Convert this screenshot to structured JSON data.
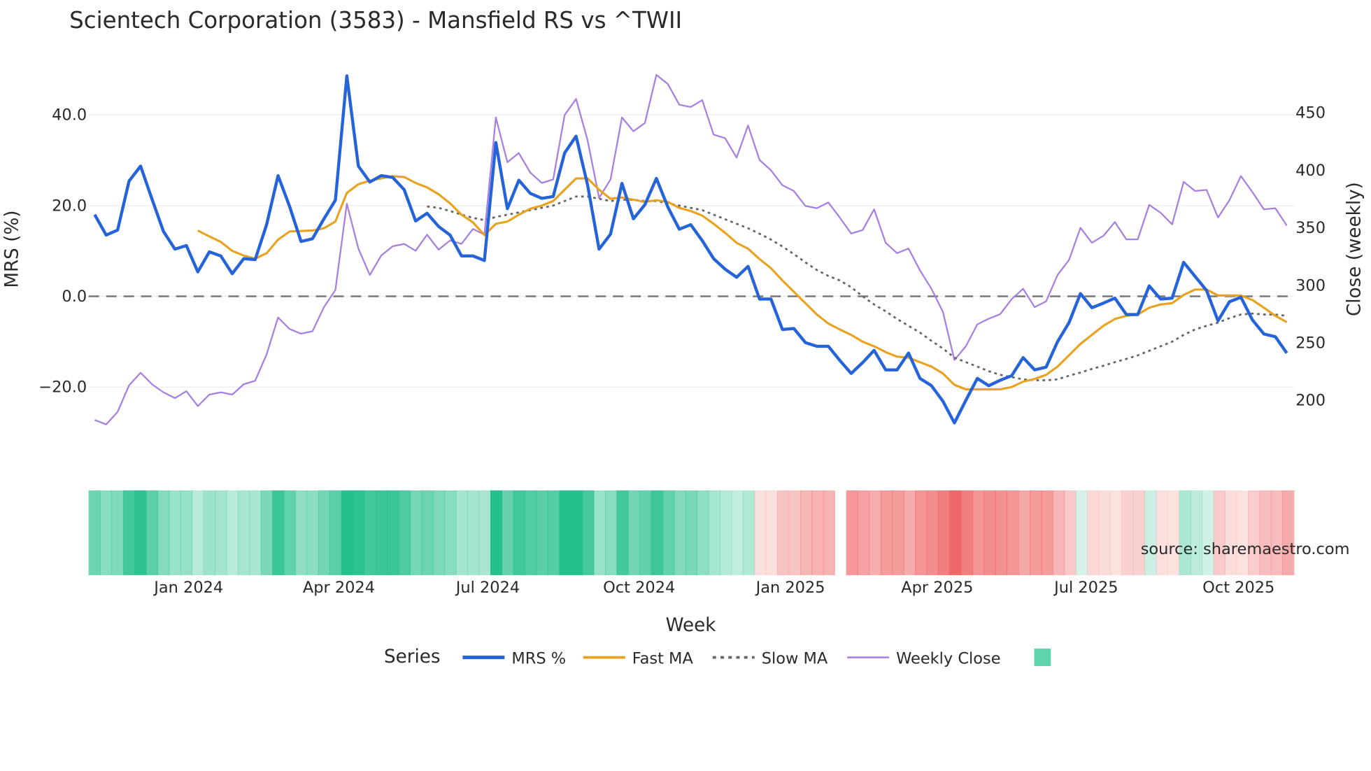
{
  "colors": {
    "mrs": "#2563d9",
    "fast": "#e8a21e",
    "slow": "#666666",
    "close": "#a67fe0",
    "green": "#26c08c",
    "red": "#ee5f5f"
  },
  "chart_data": {
    "type": "line",
    "title": "Scientech Corporation (3583) - Mansfield RS vs ^TWII",
    "xlabel": "Week",
    "ylabel": "MRS (%)",
    "y2label": "Close (weekly)",
    "ylim": [
      -33,
      53
    ],
    "y2lim": [
      150,
      490
    ],
    "yticks": [
      "40.0",
      "20.0",
      "0.0",
      "−20.0"
    ],
    "ytick_values": [
      40,
      20,
      0,
      -20
    ],
    "y2ticks": [
      "450",
      "400",
      "350",
      "300",
      "250",
      "200"
    ],
    "y2tick_values": [
      450,
      400,
      350,
      300,
      250,
      200
    ],
    "xticks": [
      "Jan 2024",
      "Apr 2024",
      "Jul 2024",
      "Oct 2024",
      "Jan 2025",
      "Apr 2025",
      "Jul 2025",
      "Oct 2025"
    ],
    "xtick_weeks": [
      8.2,
      21.3,
      34.3,
      47.5,
      60.7,
      73.5,
      86.5,
      99.8
    ],
    "n_weeks": 105,
    "heatmap_gap_week": 65,
    "legend_title": "Series",
    "legend_position": "bottom",
    "annotation": "source: sharemaestro.com",
    "series": [
      {
        "name": "MRS %",
        "start_week": 0,
        "values": [
          18,
          13.5,
          14.6,
          25.4,
          28.7,
          21.4,
          14.3,
          10.4,
          11.2,
          5.4,
          9.8,
          8.9,
          5,
          8.3,
          8.1,
          15.8,
          26.6,
          19.8,
          12.1,
          12.7,
          17.1,
          21.2,
          48.6,
          28.7,
          25.2,
          26.6,
          26.2,
          23.5,
          16.6,
          18.3,
          15.4,
          13.5,
          8.9,
          8.9,
          7.9,
          33.9,
          19.3,
          25.6,
          22.7,
          21.6,
          22,
          31.6,
          35.3,
          24.5,
          10.4,
          13.7,
          24.9,
          17.1,
          20.2,
          26,
          19.7,
          14.8,
          15.8,
          12.3,
          8.3,
          6,
          4.2,
          6.6,
          -0.6,
          -0.6,
          -7.3,
          -7.1,
          -10.2,
          -11,
          -11,
          -14.1,
          -17,
          -14.6,
          -11.9,
          -16.2,
          -16.2,
          -12.5,
          -18.1,
          -19.7,
          -23.1,
          -27.9,
          -22.9,
          -18.1,
          -19.7,
          -18.5,
          -17.5,
          -13.5,
          -16.2,
          -15.6,
          -10,
          -5.8,
          0.6,
          -2.5,
          -1.5,
          -0.4,
          -4,
          -4,
          2.3,
          -0.6,
          -0.4,
          7.5,
          4.4,
          1.3,
          -5.4,
          -1.2,
          -0.2,
          -5.2,
          -8.3,
          -8.9,
          -12.5
        ]
      },
      {
        "name": "Fast MA",
        "start_week": 9,
        "values": [
          14.5,
          13.2,
          12,
          10,
          9,
          8.3,
          9.5,
          12.5,
          14.3,
          14.4,
          14.5,
          15,
          16.5,
          22.8,
          24.7,
          25.5,
          26,
          26.5,
          26.3,
          25,
          24,
          22.5,
          20.5,
          18,
          16.3,
          13.5,
          16,
          16.5,
          18,
          19.3,
          20,
          21,
          23.5,
          26,
          26,
          23.5,
          21.5,
          21.8,
          21.3,
          20.8,
          21.2,
          20.8,
          19.5,
          18.8,
          17.8,
          16,
          14,
          11.8,
          10.5,
          8.2,
          6.2,
          3.5,
          1,
          -1.5,
          -4,
          -6,
          -7.3,
          -8.5,
          -10,
          -11,
          -12.3,
          -13.3,
          -13.5,
          -14.5,
          -15.5,
          -17,
          -19.5,
          -20.5,
          -20.5,
          -20.5,
          -20.5,
          -20,
          -18.8,
          -18.2,
          -17.3,
          -15.5,
          -13,
          -10.5,
          -8.5,
          -6.5,
          -5,
          -4.3,
          -4,
          -2.5,
          -1.8,
          -1.5,
          0.3,
          1.5,
          1.5,
          0.2,
          0.2,
          0.2,
          -0.8,
          -2.5,
          -4.3,
          -5.7
        ]
      },
      {
        "name": "Slow MA",
        "start_week": 29,
        "values": [
          19.8,
          19.5,
          18.8,
          18,
          17.3,
          16.8,
          17.5,
          18,
          18.5,
          19,
          19.5,
          20,
          21,
          22,
          22,
          21.5,
          21,
          21.3,
          21.3,
          21,
          21,
          20.5,
          20,
          19.5,
          19,
          18,
          17,
          16,
          15,
          13.8,
          12.5,
          11,
          9.3,
          7.5,
          5.8,
          4.5,
          3.5,
          2,
          0,
          -1.8,
          -3.3,
          -5,
          -6.5,
          -8,
          -9.8,
          -11.5,
          -13.5,
          -14.5,
          -15.5,
          -16.5,
          -17.3,
          -17.8,
          -18.3,
          -18.5,
          -18.5,
          -18.3,
          -17.5,
          -16.8,
          -16,
          -15.3,
          -14.5,
          -13.8,
          -13,
          -12,
          -11,
          -10,
          -8.5,
          -7.3,
          -6.5,
          -5.8,
          -4.8,
          -4,
          -3.8,
          -4,
          -4,
          -4.3
        ]
      },
      {
        "name": "Weekly Close",
        "start_week": 0,
        "axis": "y2",
        "values": [
          183,
          179,
          190,
          213,
          224,
          214,
          207,
          202,
          208,
          195,
          205,
          207,
          205,
          214,
          217,
          240,
          272,
          262,
          258,
          260,
          281,
          296,
          371,
          332,
          309,
          326,
          334,
          336,
          330,
          344,
          331,
          339,
          336,
          349,
          344,
          446,
          407,
          415,
          398,
          389,
          392,
          448,
          462,
          426,
          376,
          392,
          446,
          434,
          441,
          483,
          475,
          457,
          455,
          461,
          431,
          428,
          411,
          439,
          409,
          400,
          387,
          382,
          369,
          367,
          372,
          359,
          345,
          348,
          366,
          337,
          328,
          332,
          313,
          297,
          277,
          235,
          247,
          266,
          271,
          275,
          288,
          297,
          281,
          286,
          309,
          322,
          350,
          337,
          343,
          355,
          340,
          340,
          370,
          363,
          353,
          390,
          382,
          383,
          359,
          374,
          395,
          381,
          366,
          367,
          352
        ]
      }
    ]
  }
}
